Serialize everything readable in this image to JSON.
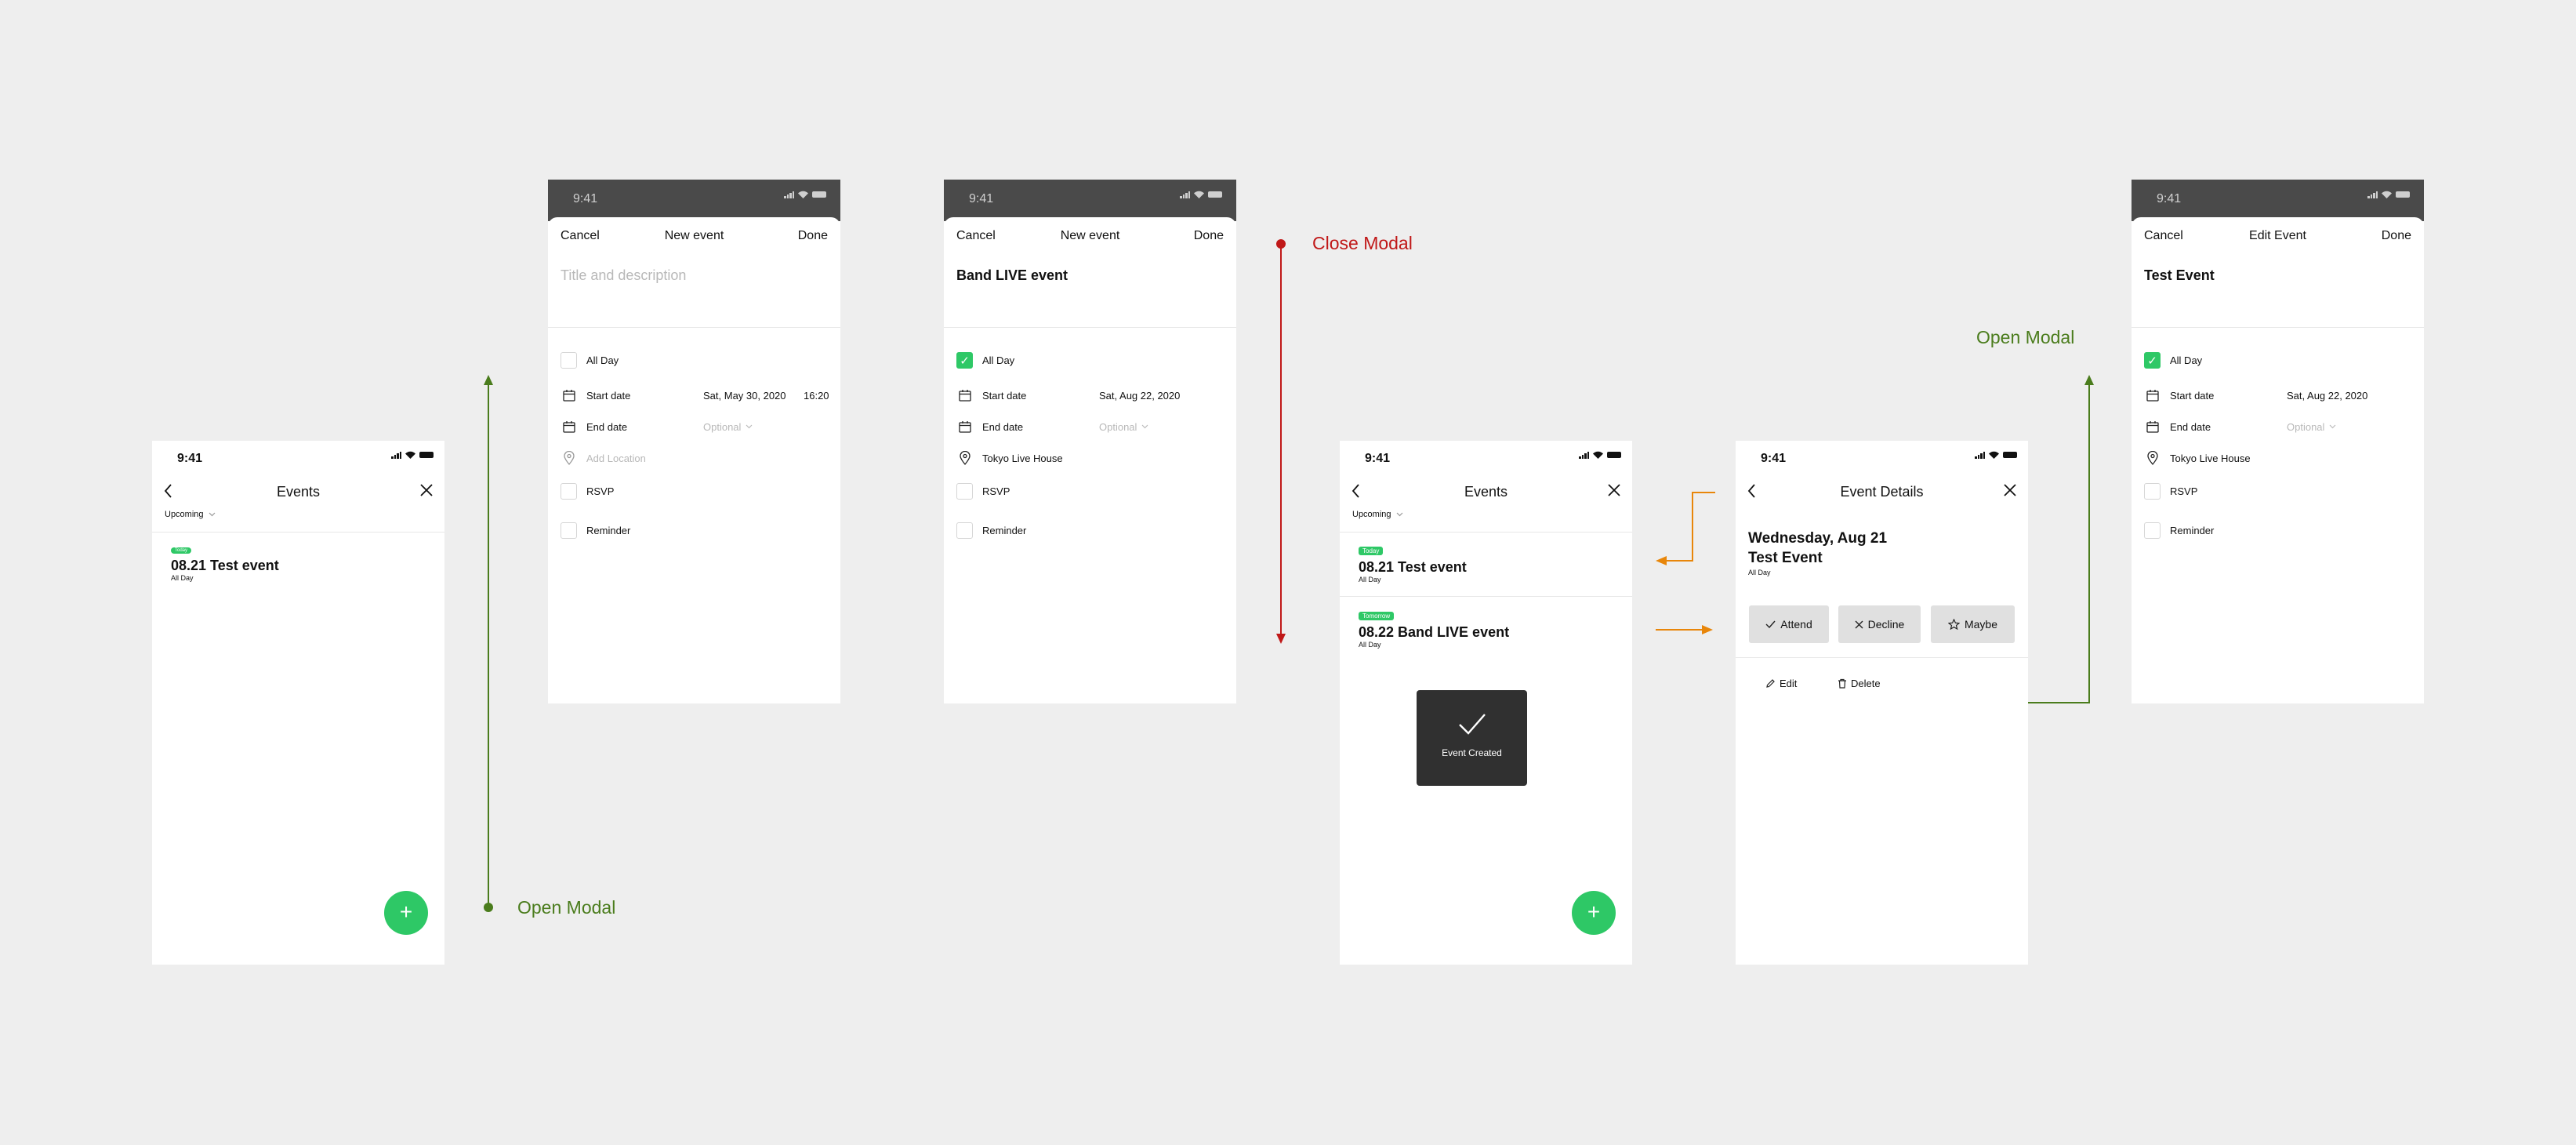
{
  "colors": {
    "accent": "#2ec866",
    "flow_green": "#4a7c1c",
    "flow_red": "#c01818",
    "flow_orange": "#e8860a"
  },
  "flow_labels": {
    "open_modal_1": "Open Modal",
    "close_modal": "Close Modal",
    "open_modal_2": "Open Modal"
  },
  "screen1": {
    "time": "9:41",
    "title": "Events",
    "filter": "Upcoming",
    "event": {
      "badge": "Today",
      "title": "08.21 Test event",
      "sub": "All Day"
    },
    "fab": "+"
  },
  "screen2": {
    "time": "9:41",
    "cancel": "Cancel",
    "title": "New event",
    "done": "Done",
    "placeholder": "Title and description",
    "allday": "All Day",
    "start_label": "Start date",
    "start_value": "Sat, May 30, 2020",
    "start_time": "16:20",
    "end_label": "End date",
    "end_value": "Optional",
    "location": "Add Location",
    "rsvp": "RSVP",
    "reminder": "Reminder"
  },
  "screen3": {
    "time": "9:41",
    "cancel": "Cancel",
    "title": "New event",
    "done": "Done",
    "event_title": "Band LIVE event",
    "allday": "All Day",
    "start_label": "Start date",
    "start_value": "Sat, Aug 22, 2020",
    "end_label": "End date",
    "end_value": "Optional",
    "location": "Tokyo Live House",
    "rsvp": "RSVP",
    "reminder": "Reminder"
  },
  "screen4": {
    "time": "9:41",
    "title": "Events",
    "filter": "Upcoming",
    "events": [
      {
        "badge": "Today",
        "title": "08.21 Test event",
        "sub": "All Day"
      },
      {
        "badge": "Tomorrow",
        "title": "08.22 Band LIVE event",
        "sub": "All Day"
      }
    ],
    "toast": "Event Created",
    "fab": "+"
  },
  "screen5": {
    "time": "9:41",
    "title": "Event Details",
    "date": "Wednesday, Aug 21",
    "event_title": "Test Event",
    "sub": "All Day",
    "attend": "Attend",
    "decline": "Decline",
    "maybe": "Maybe",
    "edit": "Edit",
    "delete": "Delete"
  },
  "screen6": {
    "time": "9:41",
    "cancel": "Cancel",
    "title": "Edit Event",
    "done": "Done",
    "event_title": "Test Event",
    "allday": "All Day",
    "start_label": "Start date",
    "start_value": "Sat, Aug 22, 2020",
    "end_label": "End date",
    "end_value": "Optional",
    "location": "Tokyo Live House",
    "rsvp": "RSVP",
    "reminder": "Reminder"
  }
}
